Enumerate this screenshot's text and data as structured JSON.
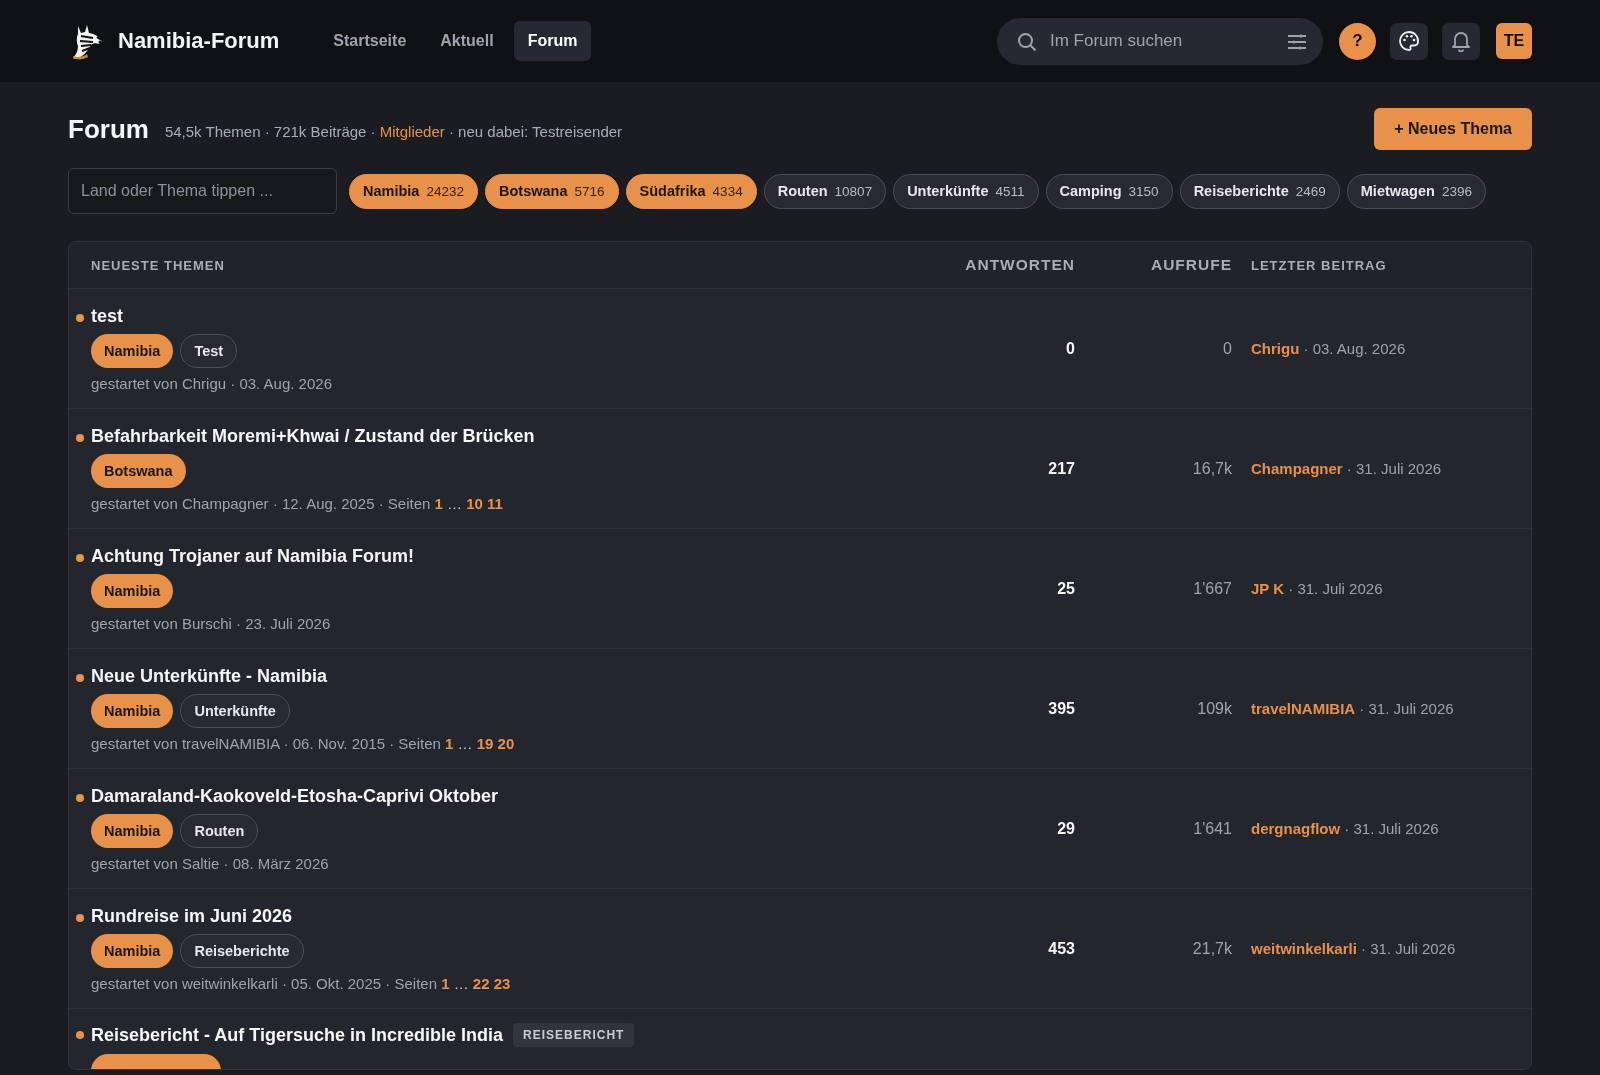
{
  "site": {
    "name": "Namibia-Forum"
  },
  "nav": [
    {
      "label": "Startseite",
      "selected": false
    },
    {
      "label": "Aktuell",
      "selected": false
    },
    {
      "label": "Forum",
      "selected": true
    }
  ],
  "search": {
    "placeholder": "Im Forum suchen"
  },
  "help_button": "?",
  "avatar": "TE",
  "forum": {
    "title": "Forum",
    "stats": "54,5k Themen · 721k Beiträge · ",
    "members_link": "Mitglieder",
    "newest": " · neu dabei: Testreisender",
    "new_topic_button": "+ Neues Thema"
  },
  "filter": {
    "placeholder": "Land oder Thema tippen ..."
  },
  "chips": [
    {
      "label": "Namibia",
      "count": "24232",
      "selected": true
    },
    {
      "label": "Botswana",
      "count": "5716",
      "selected": true
    },
    {
      "label": "Südafrika",
      "count": "4334",
      "selected": true
    },
    {
      "label": "Routen",
      "count": "10807",
      "selected": false
    },
    {
      "label": "Unterkünfte",
      "count": "4511",
      "selected": false
    },
    {
      "label": "Camping",
      "count": "3150",
      "selected": false
    },
    {
      "label": "Reiseberichte",
      "count": "2469",
      "selected": false
    },
    {
      "label": "Mietwagen",
      "count": "2396",
      "selected": false
    }
  ],
  "table": {
    "columns": [
      "NEUESTE THEMEN",
      "ANTWORTEN",
      "AUFRUFE",
      "LETZTER BEITRAG"
    ],
    "rows": [
      {
        "title": "test",
        "unread": true,
        "tags": [
          {
            "label": "Namibia",
            "kind": "country"
          },
          {
            "label": "Test",
            "kind": "category"
          }
        ],
        "meta": "gestartet von Chrigu · 03. Aug. 2026",
        "replies": "0",
        "views": "0",
        "last_user": "Chrigu",
        "last_date": " · 03. Aug. 2026"
      },
      {
        "title": "Befahrbarkeit Moremi+Khwai / Zustand der Brücken",
        "unread": true,
        "tags": [
          {
            "label": "Botswana",
            "kind": "country"
          }
        ],
        "meta": "gestartet von Champagner · 12. Aug. 2025 · Seiten ",
        "pages": [
          {
            "label": "1",
            "kind": "link"
          },
          {
            "label": "…",
            "kind": "gap"
          },
          {
            "label": "10",
            "kind": "link"
          },
          {
            "label": "11",
            "kind": "link"
          }
        ],
        "replies": "217",
        "views": "16,7k",
        "last_user": "Champagner",
        "last_date": " · 31. Juli 2026"
      },
      {
        "title": "Achtung Trojaner auf Namibia Forum!",
        "unread": true,
        "tags": [
          {
            "label": "Namibia",
            "kind": "country"
          }
        ],
        "meta": "gestartet von Burschi · 23. Juli 2026",
        "replies": "25",
        "views": "1'667",
        "last_user": "JP K",
        "last_date": " · 31. Juli 2026"
      },
      {
        "title": "Neue Unterkünfte - Namibia",
        "unread": true,
        "tags": [
          {
            "label": "Namibia",
            "kind": "country"
          },
          {
            "label": "Unterkünfte",
            "kind": "category"
          }
        ],
        "meta": "gestartet von travelNAMIBIA · 06. Nov. 2015 · Seiten ",
        "pages": [
          {
            "label": "1",
            "kind": "link"
          },
          {
            "label": "…",
            "kind": "gap"
          },
          {
            "label": "19",
            "kind": "link"
          },
          {
            "label": "20",
            "kind": "link"
          }
        ],
        "replies": "395",
        "views": "109k",
        "last_user": "travelNAMIBIA",
        "last_date": " · 31. Juli 2026"
      },
      {
        "title": "Damaraland-Kaokoveld-Etosha-Caprivi Oktober",
        "unread": true,
        "tags": [
          {
            "label": "Namibia",
            "kind": "country"
          },
          {
            "label": "Routen",
            "kind": "category"
          }
        ],
        "meta": "gestartet von Saltie · 08. März 2026",
        "replies": "29",
        "views": "1'641",
        "last_user": "dergnagflow",
        "last_date": " · 31. Juli 2026"
      },
      {
        "title": "Rundreise im Juni 2026",
        "unread": true,
        "tags": [
          {
            "label": "Namibia",
            "kind": "country"
          },
          {
            "label": "Reiseberichte",
            "kind": "category"
          }
        ],
        "meta": "gestartet von weitwinkelkarli · 05. Okt. 2025 · Seiten ",
        "pages": [
          {
            "label": "1",
            "kind": "link"
          },
          {
            "label": "…",
            "kind": "gap"
          },
          {
            "label": "22",
            "kind": "link"
          },
          {
            "label": "23",
            "kind": "link"
          }
        ],
        "replies": "453",
        "views": "21,7k",
        "last_user": "weitwinkelkarli",
        "last_date": " · 31. Juli 2026"
      },
      {
        "title": "Reisebericht - Auf Tigersuche in Incredible India",
        "unread": true,
        "badge": "REISEBERICHT",
        "tags": [
          {
            "kind": "country"
          }
        ]
      }
    ]
  }
}
